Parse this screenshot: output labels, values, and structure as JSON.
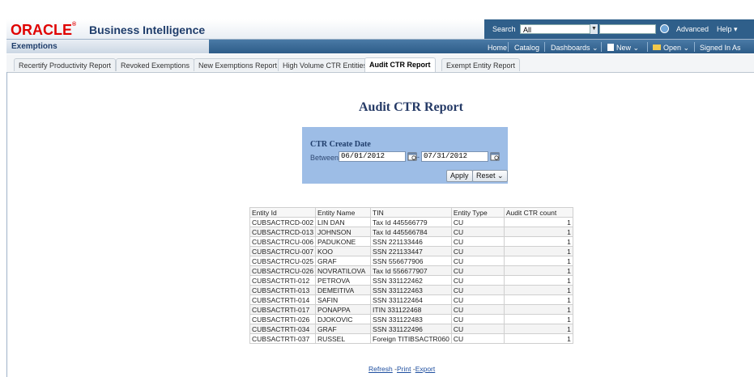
{
  "header": {
    "logo": "ORACLE",
    "product": "Business Intelligence",
    "search_label": "Search",
    "search_scope": "All",
    "advanced": "Advanced",
    "help": "Help"
  },
  "dashboard": {
    "title": "Exemptions",
    "nav": [
      "Home",
      "Catalog",
      "Dashboards",
      "New",
      "Open",
      "Signed In As"
    ]
  },
  "tabs": [
    "Recertify Productivity Report",
    "Revoked Exemptions",
    "New Exemptions Report",
    "High Volume CTR Entities",
    "Audit CTR Report",
    "Exempt Entity Report"
  ],
  "report": {
    "title": "Audit CTR Report",
    "prompt_label": "CTR Create Date",
    "between_label": "Between",
    "date_from": "06/01/2012",
    "date_to": "07/31/2012",
    "apply": "Apply",
    "reset": "Reset"
  },
  "table": {
    "columns": [
      "Entity Id",
      "Entity Name",
      "TIN",
      "Entity Type",
      "Audit CTR count"
    ],
    "rows": [
      [
        "CUBSACTRCD-002",
        "LIN DAN",
        "Tax Id 445566779",
        "CU",
        "1"
      ],
      [
        "CUBSACTRCD-013",
        "JOHNSON",
        "Tax Id 445566784",
        "CU",
        "1"
      ],
      [
        "CUBSACTRCU-006",
        "PADUKONE",
        "SSN 221133446",
        "CU",
        "1"
      ],
      [
        "CUBSACTRCU-007",
        "KOO",
        "SSN 221133447",
        "CU",
        "1"
      ],
      [
        "CUBSACTRCU-025",
        "GRAF",
        "SSN 556677906",
        "CU",
        "1"
      ],
      [
        "CUBSACTRCU-026",
        "NOVRATILOVA",
        "Tax Id 556677907",
        "CU",
        "1"
      ],
      [
        "CUBSACTRTI-012",
        "PETROVA",
        "SSN 331122462",
        "CU",
        "1"
      ],
      [
        "CUBSACTRTI-013",
        "DEMEITIVA",
        "SSN 331122463",
        "CU",
        "1"
      ],
      [
        "CUBSACTRTI-014",
        "SAFIN",
        "SSN 331122464",
        "CU",
        "1"
      ],
      [
        "CUBSACTRTI-017",
        "PONAPPA",
        "ITIN 331122468",
        "CU",
        "1"
      ],
      [
        "CUBSACTRTI-026",
        "DJOKOVIC",
        "SSN 331122483",
        "CU",
        "1"
      ],
      [
        "CUBSACTRTI-034",
        "GRAF",
        "SSN 331122496",
        "CU",
        "1"
      ],
      [
        "CUBSACTRTI-037",
        "RUSSEL",
        "Foreign TITIBSACTR060",
        "CU",
        "1"
      ]
    ]
  },
  "links": {
    "refresh": "Refresh",
    "print": "Print",
    "export": "Export"
  }
}
